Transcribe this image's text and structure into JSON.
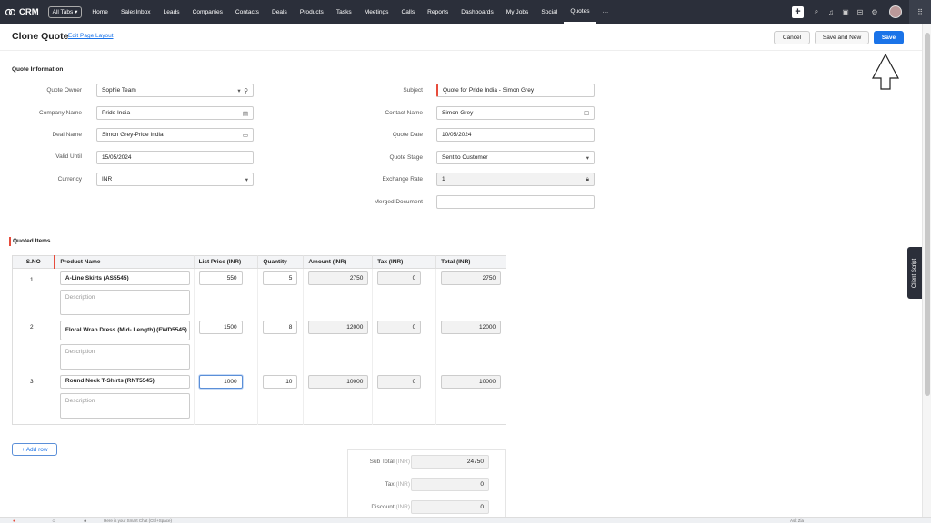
{
  "app": {
    "name": "CRM",
    "all_tabs": "All Tabs"
  },
  "nav": [
    "Home",
    "SalesInbox",
    "Leads",
    "Companies",
    "Contacts",
    "Deals",
    "Products",
    "Tasks",
    "Meetings",
    "Calls",
    "Reports",
    "Dashboards",
    "My Jobs",
    "Social",
    "Quotes",
    "···"
  ],
  "active_tab": "Quotes",
  "header": {
    "title": "Clone Quote",
    "edit_layout": "Edit Page Layout",
    "cancel": "Cancel",
    "save_new": "Save and New",
    "save": "Save"
  },
  "info": {
    "section": "Quote Information",
    "quote_owner": {
      "label": "Quote Owner",
      "value": "Sophie Team"
    },
    "company_name": {
      "label": "Company Name",
      "value": "Pride India"
    },
    "deal_name": {
      "label": "Deal Name",
      "value": "Simon Grey-Pride India"
    },
    "valid_until": {
      "label": "Valid Until",
      "value": "15/05/2024"
    },
    "currency": {
      "label": "Currency",
      "value": "INR"
    },
    "subject": {
      "label": "Subject",
      "value": "Quote for Pride India - Simon Grey"
    },
    "contact_name": {
      "label": "Contact Name",
      "value": "Simon Grey"
    },
    "quote_date": {
      "label": "Quote Date",
      "value": "10/05/2024"
    },
    "quote_stage": {
      "label": "Quote Stage",
      "value": "Sent to Customer"
    },
    "exchange_rate": {
      "label": "Exchange Rate",
      "value": "1"
    },
    "merged_document": {
      "label": "Merged Document",
      "value": ""
    }
  },
  "items": {
    "section": "Quoted Items",
    "columns": [
      "S.NO",
      "Product Name",
      "List Price (INR)",
      "Quantity",
      "Amount (INR)",
      "Tax (INR)",
      "Total (INR)"
    ],
    "rows": [
      {
        "sno": "1",
        "product": "A-Line Skirts (AS5545)",
        "price": "550",
        "qty": "5",
        "amount": "2750",
        "tax": "0",
        "total": "2750",
        "desc": "Description"
      },
      {
        "sno": "2",
        "product": "Floral Wrap Dress (Mid- Length) (FWD5545)",
        "price": "1500",
        "qty": "8",
        "amount": "12000",
        "tax": "0",
        "total": "12000",
        "desc": "Description"
      },
      {
        "sno": "3",
        "product": "Round Neck T-Shirts (RNT5545)",
        "price": "1000",
        "qty": "10",
        "amount": "10000",
        "tax": "0",
        "total": "10000",
        "desc": "Description"
      }
    ],
    "add_row": "+ Add row"
  },
  "summary": {
    "sub_total": {
      "label": "Sub Total",
      "unit": "(INR)",
      "value": "24750"
    },
    "tax": {
      "label": "Tax",
      "unit": "(INR)",
      "value": "0"
    },
    "discount": {
      "label": "Discount",
      "unit": "(INR)",
      "value": "0"
    }
  },
  "client_script": "Client Script",
  "bottom": {
    "chat_hint": "Here is your Smart Chat (Ctrl+Space)",
    "ask_zia": "Ask Zia"
  }
}
